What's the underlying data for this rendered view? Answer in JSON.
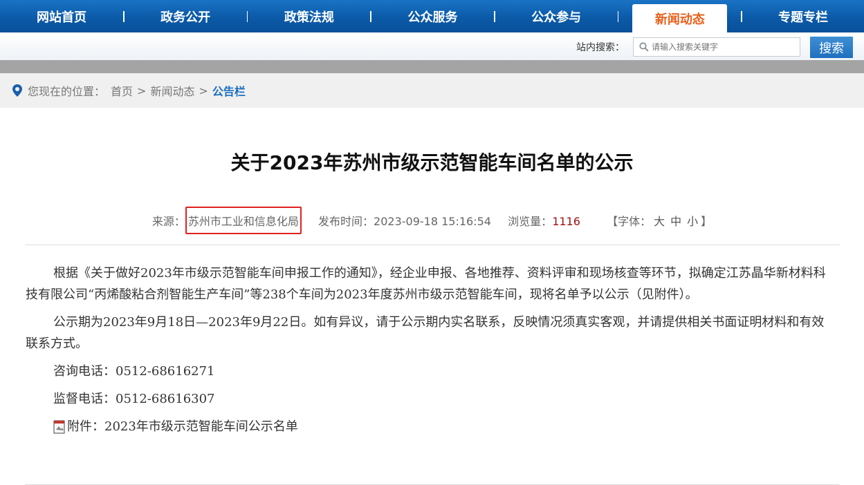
{
  "nav": {
    "items": [
      {
        "label": "网站首页"
      },
      {
        "label": "政务公开"
      },
      {
        "label": "政策法规"
      },
      {
        "label": "公众服务"
      },
      {
        "label": "公众参与"
      },
      {
        "label": "新闻动态",
        "active": true
      },
      {
        "label": "专题专栏"
      }
    ]
  },
  "search": {
    "label": "站内搜索：",
    "placeholder": "请输入搜索关键字",
    "button": "搜索"
  },
  "breadcrumb": {
    "prefix": "您现在的位置：",
    "home": "首页",
    "section": "新闻动态",
    "current": "公告栏",
    "separator": ">"
  },
  "article": {
    "title": "关于2023年苏州市级示范智能车间名单的公示",
    "source_label": "来源：",
    "source": "苏州市工业和信息化局",
    "publish_label": "发布时间：",
    "publish_time": "2023-09-18 15:16:54",
    "views_label": "浏览量：",
    "views": "1116",
    "font_label_open": "【字体：",
    "font_large": "大",
    "font_medium": "中",
    "font_small": "小",
    "font_label_close": "】",
    "paragraphs": [
      "根据《关于做好2023年市级示范智能车间申报工作的通知》，经企业申报、各地推荐、资料评审和现场核查等环节，拟确定江苏晶华新材料科技有限公司“丙烯酸粘合剂智能生产车间”等238个车间为2023年度苏州市级示范智能车间，现将名单予以公示（见附件）。",
      "公示期为2023年9月18日—2023年9月22日。如有异议，请于公示期内实名联系，反映情况须真实客观，并请提供相关书面证明材料和有效联系方式。",
      "咨询电话：0512-68616271",
      "监督电话：0512-68616307"
    ],
    "attachment": "附件：2023年市级示范智能车间公示名单"
  },
  "colors": {
    "nav_bg": "#0b5aa8",
    "nav_active_text": "#e8601c",
    "breadcrumb_current": "#1a6fc0",
    "views_value": "#a01010",
    "highlight_box": "#e02020"
  }
}
